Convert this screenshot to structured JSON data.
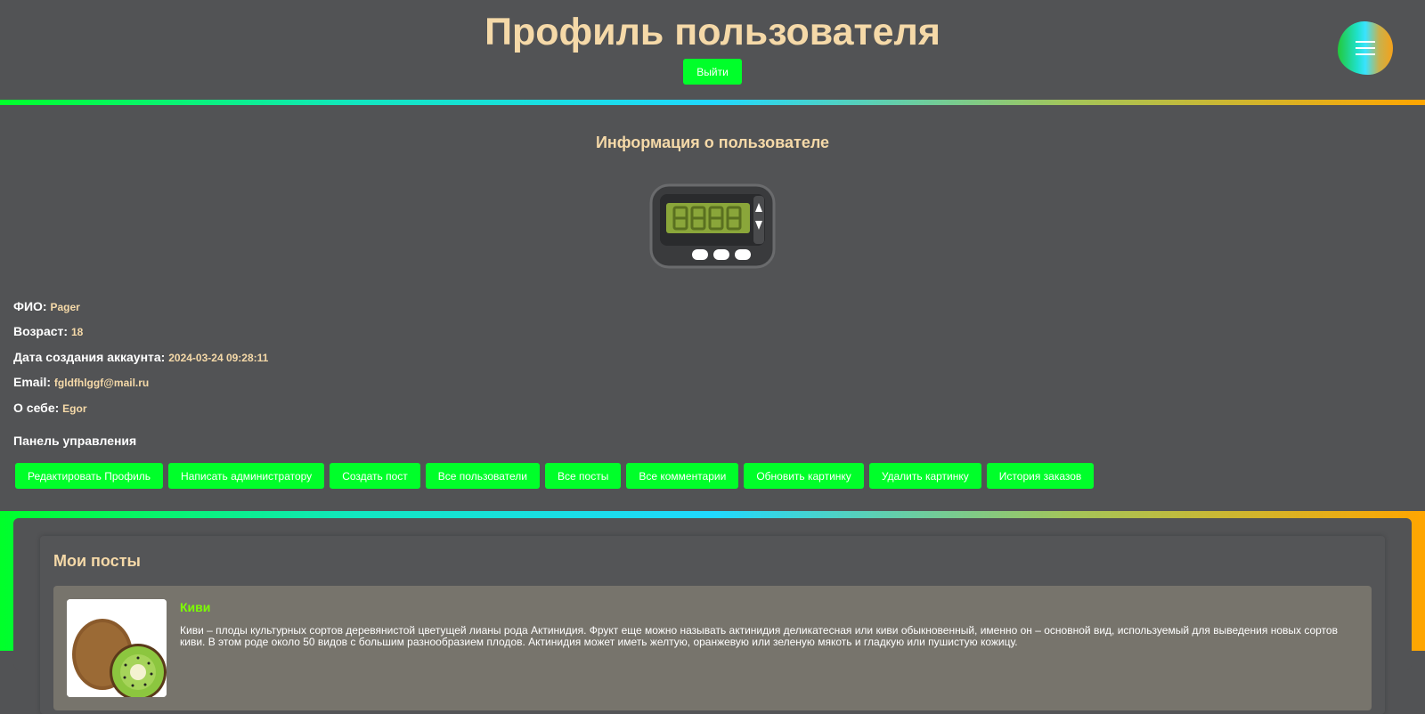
{
  "header": {
    "title": "Профиль пользователя",
    "logout_label": "Выйти",
    "menu_icon": "hamburger-icon"
  },
  "info": {
    "title": "Информация о пользователе",
    "avatar_icon": "pager-icon",
    "fields": [
      {
        "label": "ФИО:",
        "value": "Pager"
      },
      {
        "label": "Возраст:",
        "value": "18"
      },
      {
        "label": "Дата создания аккаунта:",
        "value": "2024-03-24 09:28:11"
      },
      {
        "label": "Email:",
        "value": "fgldfhlggf@mail.ru"
      },
      {
        "label": "О себе:",
        "value": "Egor"
      }
    ],
    "panel_label": "Панель управления",
    "buttons": [
      "Редактировать Профиль",
      "Написать администратору",
      "Создать пост",
      "Все пользователи",
      "Все посты",
      "Все комментарии",
      "Обновить картинку",
      "Удалить картинку",
      "История заказов"
    ]
  },
  "posts": {
    "title": "Мои посты",
    "items": [
      {
        "title": "Киви",
        "text": "Киви – плоды культурных сортов деревянистой цветущей лианы рода Актинидия. Фрукт еще можно называть актинидия деликатесная или киви обыкновенный, именно он – основной вид, используемый для выведения новых сортов киви. В этом роде около 50 видов с большим разнообразием плодов. Актинидия может иметь желтую, оранжевую или зеленую мякоть и гладкую или пушистую кожицу.",
        "image_icon": "kiwi-image"
      }
    ]
  },
  "colors": {
    "accent_green": "#00ff2a",
    "title_beige": "#f5d9a8",
    "background": "#525355",
    "post_title_green": "#7cff00"
  }
}
